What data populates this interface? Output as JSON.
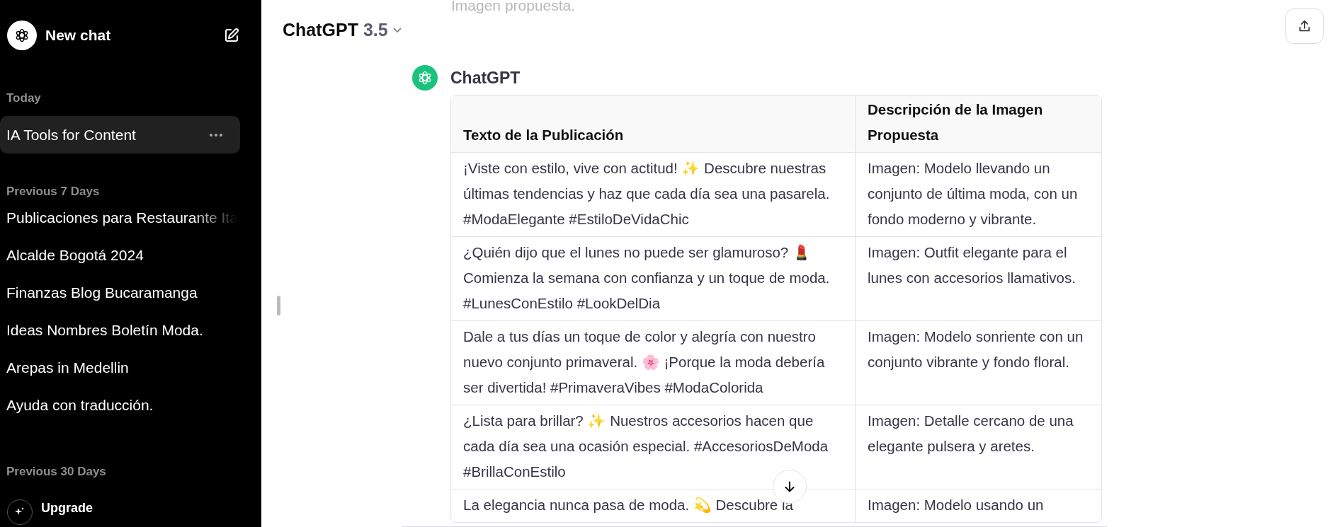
{
  "sidebar": {
    "new_chat": "New chat",
    "sections": [
      {
        "heading": "Today",
        "items": [
          {
            "label": "IA Tools for Content",
            "selected": true,
            "faded": false
          }
        ]
      },
      {
        "heading": "Previous 7 Days",
        "items": [
          {
            "label": "Publicaciones para Restaurante Ita",
            "selected": false,
            "faded": true
          },
          {
            "label": "Alcalde Bogotá 2024",
            "selected": false,
            "faded": false
          },
          {
            "label": "Finanzas Blog Bucaramanga",
            "selected": false,
            "faded": false
          },
          {
            "label": "Ideas Nombres Boletín Moda.",
            "selected": false,
            "faded": false
          },
          {
            "label": "Arepas in Medellin",
            "selected": false,
            "faded": false
          },
          {
            "label": "Ayuda con traducción.",
            "selected": false,
            "faded": false
          }
        ]
      },
      {
        "heading": "Previous 30 Days"
      }
    ],
    "upgrade": "Upgrade"
  },
  "header": {
    "model": "ChatGPT",
    "version": "3.5"
  },
  "conversation": {
    "faded_text": "Imagen propuesta.",
    "author": "ChatGPT",
    "table": {
      "columns": [
        "Texto de la Publicación",
        "Descripción de la Imagen Propuesta"
      ],
      "rows": [
        [
          "¡Viste con estilo, vive con actitud! ✨ Descubre nuestras últimas tendencias y haz que cada día sea una pasarela. #ModaElegante #EstiloDeVidaChic",
          "Imagen: Modelo llevando un conjunto de última moda, con un fondo moderno y vibrante."
        ],
        [
          "¿Quién dijo que el lunes no puede ser glamuroso? 💄 Comienza la semana con confianza y un toque de moda. #LunesConEstilo #LookDelDia",
          "Imagen: Outfit elegante para el lunes con accesorios llamativos."
        ],
        [
          "Dale a tus días un toque de color y alegría con nuestro nuevo conjunto primaveral. 🌸 ¡Porque la moda debería ser divertida! #PrimaveraVibes #ModaColorida",
          "Imagen: Modelo sonriente con un conjunto vibrante y fondo floral."
        ],
        [
          "¿Lista para brillar? ✨ Nuestros accesorios hacen que cada día sea una ocasión especial. #AccesoriosDeModa #BrillaConEstilo",
          "Imagen: Detalle cercano de una elegante pulsera y aretes."
        ],
        [
          "La elegancia nunca pasa de moda. 💫 Descubre la",
          "Imagen: Modelo usando un"
        ]
      ]
    }
  }
}
